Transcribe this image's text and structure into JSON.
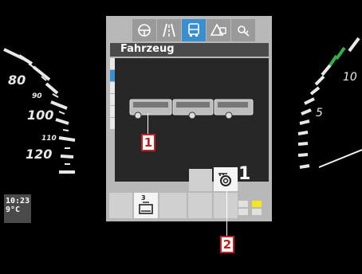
{
  "speedometer": {
    "labels": [
      "80",
      "90",
      "100",
      "110",
      "120"
    ]
  },
  "clock": {
    "time": "10:23",
    "temp": "9°C"
  },
  "rpm": {
    "labels": [
      "10",
      "5"
    ]
  },
  "display": {
    "tabs": [
      {
        "icon": "steering-wheel-icon",
        "active": false
      },
      {
        "icon": "road-icon",
        "active": false
      },
      {
        "icon": "bus-icon",
        "active": true
      },
      {
        "icon": "warning-icon",
        "active": false
      },
      {
        "icon": "settings-icon",
        "active": false
      }
    ],
    "title": "Fahrzeug",
    "key_count": "1",
    "gear_slot_number": "3",
    "colors": {
      "active_tab": "#3a8fd0",
      "indicator": "#f6e71a",
      "callout_border": "#c81e1e"
    }
  },
  "callouts": [
    "1",
    "2"
  ]
}
